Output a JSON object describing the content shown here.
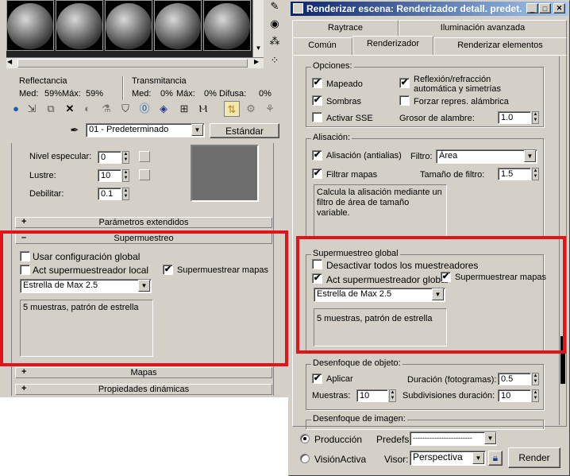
{
  "material_editor": {
    "reflectance": {
      "label": "Reflectancia",
      "med_label": "Med:",
      "med": "59%",
      "max_label": "Máx:",
      "max": "59%"
    },
    "transmittance": {
      "label": "Transmitancia",
      "med_label": "Med:",
      "med": "0%",
      "max_label": "Máx:",
      "max": "0%",
      "diffuse_label": "Difusa:",
      "diffuse": "0%"
    },
    "material_name": "01 - Predeterminado",
    "material_type": "Estándar",
    "specular_level_label": "Nivel especular:",
    "specular_level": "0",
    "glossiness_label": "Lustre:",
    "glossiness": "10",
    "soften_label": "Debilitar:",
    "soften": "0.1",
    "rollout_extended": "Parámetros extendidos",
    "rollout_supersampling": "Supermuestreo",
    "use_global_label": "Usar configuración global",
    "local_ss_label": "Act supermuestreador local",
    "ss_maps_label": "Supermuestrear mapas",
    "ss_method": "Estrella de Max 2.5",
    "ss_description": "5 muestras, patrón de estrella",
    "rollout_maps": "Mapas",
    "rollout_dynamics": "Propiedades dinámicas"
  },
  "render_dialog": {
    "title": "Renderizar escena: Renderizador detall. predet.",
    "tabs_back": [
      "Raytrace",
      "Iluminación avanzada"
    ],
    "tabs_front": [
      "Común",
      "Renderizador",
      "Renderizar elementos"
    ],
    "options": {
      "group_label": "Opciones:",
      "mapping": "Mapeado",
      "mapping_checked": "✔",
      "reflection_line1": "Reflexión/refracción",
      "reflection_line2": "automática y simetrías",
      "reflection_checked": "✔",
      "shadows": "Sombras",
      "shadows_checked": "✔",
      "force_wire": "Forzar repres. alámbrica",
      "ssse": "Activar SSE",
      "wire_thickness_label": "Grosor de alambre:",
      "wire_thickness": "1.0"
    },
    "antialias": {
      "group_label": "Alisación:",
      "aa_label": "Alisación (antialias)",
      "filter_label": "Filtro:",
      "filter": "Área",
      "filter_maps": "Filtrar mapas",
      "filter_size_label": "Tamaño de filtro:",
      "filter_size": "1.5",
      "description": "Calcula la alisación mediante un filtro de área de tamaño variable."
    },
    "global_ss": {
      "group_label": "Supermuestreo global",
      "disable_all": "Desactivar todos los muestreadores",
      "enable_global": "Act supermuestreador global",
      "ss_maps": "Supermuestrear mapas",
      "method": "Estrella de Max 2.5",
      "description": "5 muestras, patrón de estrella"
    },
    "object_blur": {
      "group_label": "Desenfoque de objeto:",
      "apply": "Aplicar",
      "duration_label": "Duración (fotogramas):",
      "duration": "0.5",
      "samples_label": "Muestras:",
      "samples": "10",
      "subdiv_label": "Subdivisiones duración:",
      "subdiv": "10"
    },
    "image_blur": {
      "group_label": "Desenfoque de imagen:"
    },
    "bottom": {
      "production": "Producción",
      "activeshade": "VisiónActiva",
      "presets_label": "Predefs:",
      "presets": "-------------------------",
      "viewport_label": "Visor:",
      "viewport": "Perspectiva",
      "render_button": "Render"
    }
  },
  "colors": {
    "highlight_red": "#e0141a",
    "title_blue": "#0a246a",
    "panel_gray": "#d4d0c8"
  }
}
